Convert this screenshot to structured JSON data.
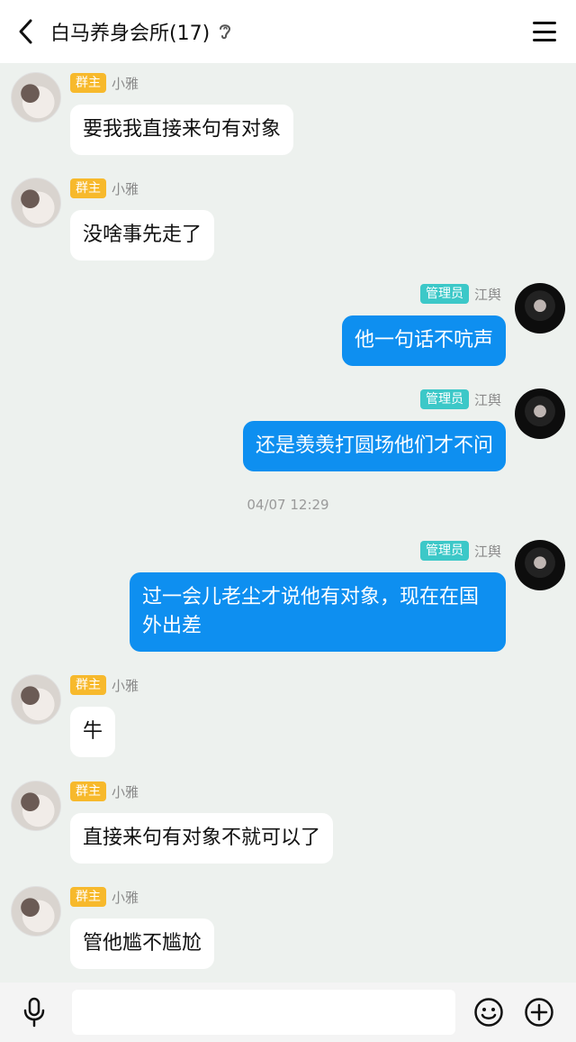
{
  "header": {
    "title": "白马养身会所(17)",
    "icons": {
      "back": "chevron-left-icon",
      "ear": "ear-icon",
      "menu": "menu-icon"
    }
  },
  "colors": {
    "background": "#edf1ee",
    "owner_badge": "#f7b92c",
    "admin_badge": "#3cc8c8",
    "outgoing_bubble": "#0e8ff0",
    "incoming_bubble": "#ffffff"
  },
  "messages": [
    {
      "role": "群主",
      "name": "小雅",
      "text": "要我我直接来句有对象"
    },
    {
      "role": "群主",
      "name": "小雅",
      "text": "没啥事先走了"
    },
    {
      "role": "管理员",
      "name": "江舆",
      "text": "他一句话不吭声"
    },
    {
      "role": "管理员",
      "name": "江舆",
      "text": "还是羡羡打圆场他们才不问"
    },
    {
      "role": "管理员",
      "name": "江舆",
      "text": "过一会儿老尘才说他有对象，现在在国外出差"
    },
    {
      "role": "群主",
      "name": "小雅",
      "text": "牛"
    },
    {
      "role": "群主",
      "name": "小雅",
      "text": "直接来句有对象不就可以了"
    },
    {
      "role": "群主",
      "name": "小雅",
      "text": "管他尴不尴尬"
    }
  ],
  "timestamp": "04/07 12:29",
  "input_bar": {
    "value": "",
    "icons": {
      "voice": "microphone-icon",
      "emoji": "emoji-icon",
      "more": "plus-icon"
    }
  }
}
